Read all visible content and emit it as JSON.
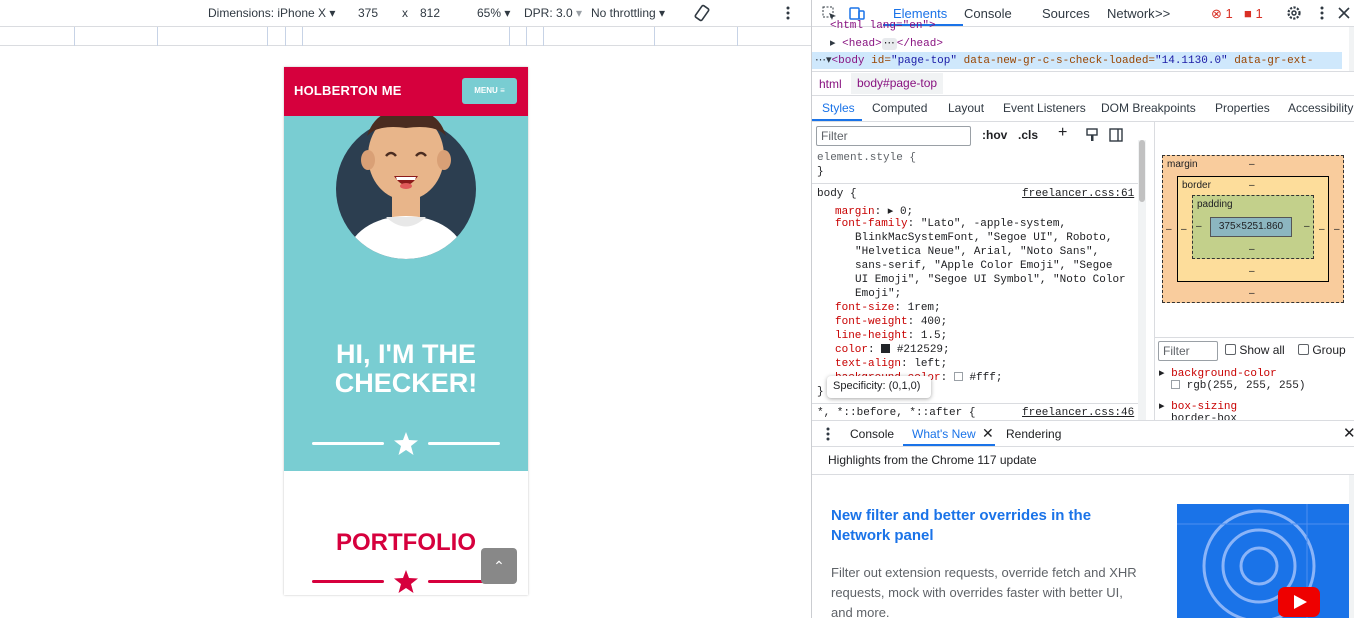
{
  "device_toolbar": {
    "dimensions_label": "Dimensions: iPhone X",
    "width": "375",
    "times": "x",
    "height": "812",
    "zoom": "65%",
    "dpr": "DPR: 3.0",
    "throttle": "No throttling"
  },
  "page": {
    "brand": "HOLBERTON ME",
    "menu_label": "MENU",
    "hero_title": "HI, I'M THE CHECKER!",
    "section_title": "PORTFOLIO",
    "colors": {
      "primary": "#d6003d",
      "hero_bg": "#79cdd2",
      "avatar_bg": "#2c3e50"
    }
  },
  "devtools": {
    "tabs": [
      "Elements",
      "Console",
      "Sources",
      "Network"
    ],
    "more_tabs": ">>",
    "error_count": "1",
    "issue_count": "1",
    "code_lines": {
      "line0": "<html lang=\"en\">",
      "head_open": "<head>",
      "head_close": "</head>",
      "body_tag": "<body",
      "body_id_attr": "id=",
      "body_id_val": "\"page-top\"",
      "body_attr2": "data-new-gr-c-s-check-loaded=",
      "body_attr2_val": "\"14.1130.0\"",
      "body_attr3": "data-gr-ext-"
    },
    "breadcrumbs": [
      "html",
      "body#page-top"
    ],
    "subtabs": [
      "Styles",
      "Computed",
      "Layout",
      "Event Listeners",
      "DOM Breakpoints",
      "Properties",
      "Accessibility"
    ],
    "filter_placeholder": "Filter",
    "hov": ":hov",
    "cls": ".cls",
    "element_style": "element.style {",
    "close_brace": "}",
    "body_selector": "body {",
    "source_link": "freelancer.css:61",
    "props": [
      {
        "name": "margin",
        "value": "0;"
      },
      {
        "name": "font-family",
        "value": "\"Lato\", -apple-system,"
      },
      {
        "name": "font-size",
        "value": "1rem;"
      },
      {
        "name": "font-weight",
        "value": "400;"
      },
      {
        "name": "line-height",
        "value": "1.5;"
      },
      {
        "name": "color",
        "value": "#212529;"
      },
      {
        "name": "text-align",
        "value": "left;"
      },
      {
        "name": "background-color",
        "value": "#fff;"
      }
    ],
    "font_family_cont": [
      "BlinkMacSystemFont, \"Segoe UI\", Roboto,",
      "\"Helvetica Neue\", Arial, \"Noto Sans\",",
      "sans-serif, \"Apple Color Emoji\", \"Segoe",
      "UI Emoji\", \"Segoe UI Symbol\", \"Noto Color",
      "Emoji\";"
    ],
    "tooltip": "Specificity: (0,1,0)",
    "universal_selector": "*, *::before, *::after {",
    "universal_source": "freelancer.css:46",
    "boxmodel": {
      "margin": "margin",
      "border": "border",
      "padding": "padding",
      "content": "375×5251.860",
      "dash": "–"
    },
    "computed_filter": "Filter",
    "show_all": "Show all",
    "group": "Group",
    "computed_props": [
      {
        "name": "background-color",
        "value": "rgb(255, 255, 255)"
      },
      {
        "name": "box-sizing",
        "value": "border-box"
      }
    ],
    "drawer_tabs": [
      "Console",
      "What's New",
      "Rendering"
    ],
    "whatsnew_header": "Highlights from the Chrome 117 update",
    "whatsnew_title": "New filter and better overrides in the Network panel",
    "whatsnew_body": "Filter out extension requests, override fetch and XHR requests, mock with overrides faster with better UI, and more."
  }
}
